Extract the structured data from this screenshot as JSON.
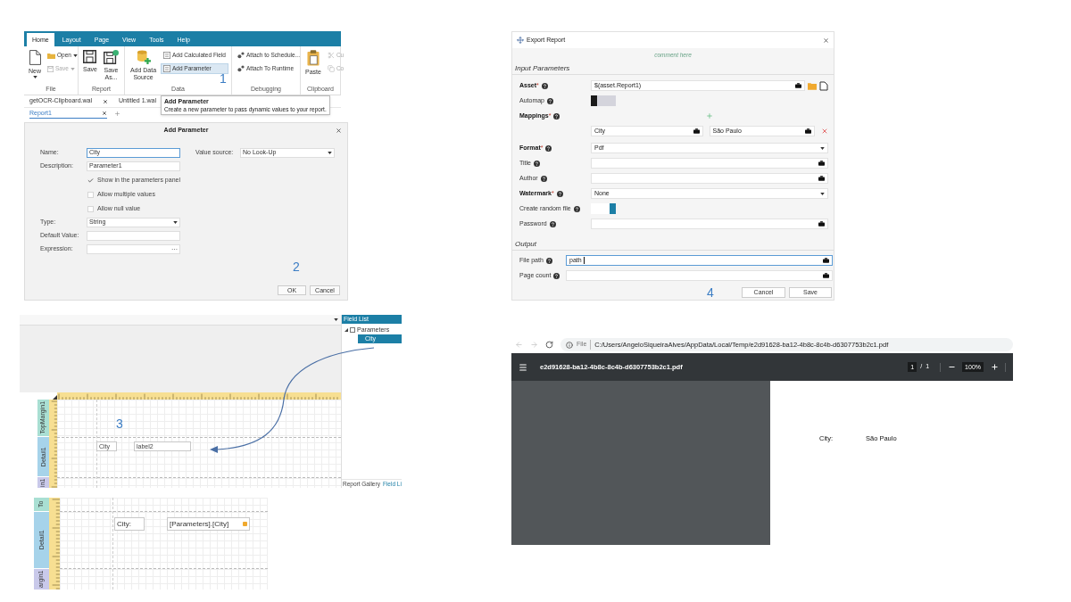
{
  "ribbon": {
    "tabs": [
      {
        "label": "Home",
        "selected": true
      },
      {
        "label": "Layout",
        "selected": false
      },
      {
        "label": "Page",
        "selected": false
      },
      {
        "label": "View",
        "selected": false
      },
      {
        "label": "Tools",
        "selected": false
      },
      {
        "label": "Help",
        "selected": false
      }
    ],
    "groups": [
      {
        "label": "File",
        "items": [
          {
            "kind": "large",
            "label": "New",
            "dropdown": true
          },
          {
            "kind": "small",
            "label": "Open",
            "dropdown": true,
            "disabled": false
          },
          {
            "kind": "small",
            "label": "Save",
            "dropdown": true,
            "disabled": true
          }
        ]
      },
      {
        "label": "Report",
        "items": [
          {
            "kind": "large",
            "label": "Save"
          },
          {
            "kind": "large",
            "label": "Save As..."
          }
        ]
      },
      {
        "label": "Data",
        "items": [
          {
            "kind": "large",
            "label": "Add Data Source"
          },
          {
            "kind": "small",
            "label": "Add Calculated Field",
            "hovered": false
          },
          {
            "kind": "small",
            "label": "Add Parameter",
            "hovered": true
          }
        ]
      },
      {
        "label": "Debugging",
        "items": [
          {
            "kind": "small",
            "label": "Attach to Schedule..."
          },
          {
            "kind": "small",
            "label": "Attach To Runtime"
          }
        ]
      },
      {
        "label": "Clipboard",
        "items": [
          {
            "kind": "large",
            "label": "Paste"
          },
          {
            "kind": "small",
            "label": "Cu",
            "disabled": true
          },
          {
            "kind": "small",
            "label": "Co",
            "disabled": true
          }
        ]
      }
    ],
    "step": "1"
  },
  "documents": {
    "tabs": [
      {
        "label": "getOCR-Clipboard.wal",
        "closable": true
      },
      {
        "label": "Untitled 1.wal"
      }
    ],
    "report_tabs": [
      {
        "label": "Report1",
        "closable": true
      }
    ]
  },
  "tooltip": {
    "title": "Add Parameter",
    "text": "Create a new parameter to pass dynamic values to your report."
  },
  "add_parameter": {
    "title": "Add Parameter",
    "fields": [
      {
        "kind": "input",
        "label": "Name:",
        "value": "City",
        "focused": true
      },
      {
        "kind": "input",
        "label": "Description:",
        "value": "Parameter1",
        "focused": false
      },
      {
        "kind": "checkbox",
        "label": "Show in the parameters panel",
        "checked": true
      },
      {
        "kind": "checkbox",
        "label": "Allow multiple values",
        "checked": false
      },
      {
        "kind": "checkbox",
        "label": "Allow null value",
        "checked": false
      },
      {
        "kind": "select",
        "label": "Type:",
        "value": "String"
      },
      {
        "kind": "input",
        "label": "Default Value:",
        "focused": false
      },
      {
        "kind": "input",
        "label": "Expression:",
        "focused": false,
        "button": "···"
      }
    ],
    "value_source": {
      "label": "Value source:",
      "value": "No Look-Up"
    },
    "buttons": [
      "OK",
      "Cancel"
    ],
    "step": "2"
  },
  "designer": {
    "bands": [
      {
        "label": "TopMargin1",
        "color": "#a9dfd3"
      },
      {
        "label": "Detail1",
        "color": "#a6d3ea"
      },
      {
        "label": "in1",
        "color": "#c9c9ea"
      }
    ],
    "controls": [
      {
        "kind": "label",
        "text": "City"
      },
      {
        "kind": "label",
        "text": "label2"
      }
    ],
    "field_list": {
      "title": "Field List",
      "tree": [
        {
          "label": "Parameters",
          "expanded": true,
          "children": [
            {
              "label": "City",
              "selected": true
            }
          ]
        }
      ],
      "tabs": [
        {
          "label": "Report Gallery",
          "selected": false
        },
        {
          "label": "Field Li",
          "selected": true
        }
      ]
    },
    "step": "3"
  },
  "designer_detail": {
    "bands": [
      {
        "label": "To",
        "color": "#a9dfd3"
      },
      {
        "label": "Detail1",
        "color": "#a6d3ea"
      },
      {
        "label": "argin1",
        "color": "#c9c9ea"
      }
    ],
    "controls": [
      {
        "kind": "label",
        "text": "City:"
      },
      {
        "kind": "expression",
        "text": "[Parameters].[City]"
      }
    ]
  },
  "export_report": {
    "title": "Export Report",
    "comment": "comment here",
    "sections": [
      {
        "heading": "Input Parameters",
        "rows": [
          {
            "kind": "asset",
            "label": "Asset",
            "required_mark": "*",
            "value": "$(asset.Report1)"
          },
          {
            "kind": "toggle",
            "label": "Automap",
            "on": false
          },
          {
            "kind": "mappings",
            "label": "Mappings",
            "required_mark": "*",
            "items": [
              {
                "name": "City",
                "value": "São Paulo"
              }
            ]
          },
          {
            "kind": "select",
            "label": "Format",
            "required_mark": "*",
            "value": "Pdf"
          },
          {
            "kind": "input",
            "label": "Title",
            "focused": false
          },
          {
            "kind": "input",
            "label": "Author",
            "focused": false
          },
          {
            "kind": "select",
            "label": "Watermark",
            "required_mark": "*",
            "value": "None"
          },
          {
            "kind": "toggle",
            "label": "Create random file",
            "on": true
          },
          {
            "kind": "input",
            "label": "Password",
            "focused": false
          }
        ]
      },
      {
        "heading": "Output",
        "rows": [
          {
            "kind": "input",
            "label": "File path",
            "value": "path",
            "focused": true
          },
          {
            "kind": "input",
            "label": "Page count",
            "focused": false
          }
        ]
      }
    ],
    "buttons": [
      "Cancel",
      "Save"
    ],
    "step": "4"
  },
  "pdf_viewer": {
    "browser": {
      "scheme": "File",
      "url": "C:/Users/AngeloSiqueiraAlves/AppData/Local/Temp/e2d91628-ba12-4b8c-8c4b-d6307753b2c1.pdf"
    },
    "toolbar": {
      "filename": "e2d91628-ba12-4b8c-8c4b-d6307753b2c1.pdf",
      "page": "1",
      "page_separator": "/",
      "page_total": "1",
      "zoom": "100%"
    },
    "page_rows": [
      {
        "label": "City:",
        "value": "São Paulo"
      }
    ]
  }
}
